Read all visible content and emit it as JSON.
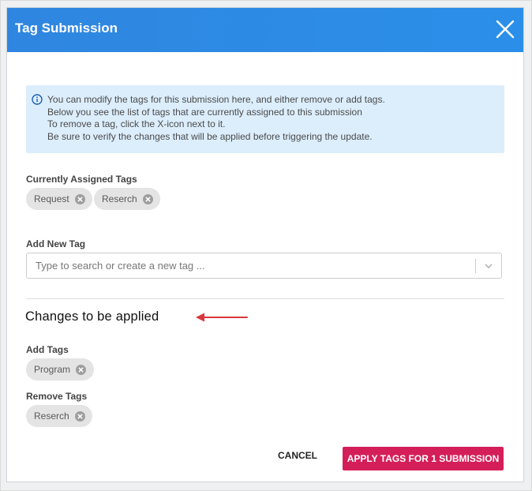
{
  "dialog": {
    "title": "Tag Submission"
  },
  "info": {
    "lines": [
      "You can modify the tags for this submission here, and either remove or add tags.",
      "Below you see the list of tags that are currently assigned to this submission",
      "To remove a tag, click the X-icon next to it.",
      "Be sure to verify the changes that will be applied before triggering the update."
    ]
  },
  "current": {
    "label": "Currently Assigned Tags",
    "tags": [
      "Request",
      "Reserch"
    ]
  },
  "add_new": {
    "label": "Add New Tag",
    "placeholder": "Type to search or create a new tag ..."
  },
  "changes": {
    "title": "Changes to be applied",
    "add_label": "Add Tags",
    "add_tags": [
      "Program"
    ],
    "remove_label": "Remove Tags",
    "remove_tags": [
      "Reserch"
    ]
  },
  "footer": {
    "cancel": "CANCEL",
    "apply": "APPLY TAGS FOR 1 SUBMISSION"
  },
  "colors": {
    "header": "#2b8fe9",
    "apply_button": "#d41e5a",
    "info_bg": "#dceefc",
    "annotation_arrow": "#d9363e"
  }
}
